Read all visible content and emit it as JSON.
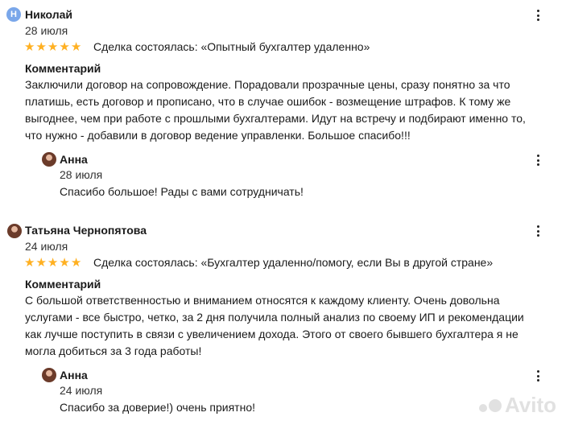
{
  "reviews": [
    {
      "author": "Николай",
      "avatar_letter": "Н",
      "date": "28 июля",
      "rating": 5,
      "deal": "Сделка состоялась: «Опытный бухгалтер удаленно»",
      "comment_title": "Комментарий",
      "comment_lines": [
        "Заключили договор на сопровождение. Порадовали прозрачные цены, сразу понятно за что",
        "платишь, есть договор и прописано, что в случае ошибок - возмещение штрафов. К тому же",
        "выгоднее, чем при работе с прошлыми бухгалтерами. Идут на встречу и подбирают именно то,",
        "что нужно - добавили в договор ведение управленки. Большое спасибо!!!"
      ],
      "reply": {
        "author": "Анна",
        "date": "28 июля",
        "text": "Спасибо большое! Рады с вами сотрудничать!"
      }
    },
    {
      "author": "Татьяна Чернопятова",
      "date": "24 июля",
      "rating": 5,
      "deal": "Сделка состоялась: «Бухгалтер удаленно/помогу, если Вы в другой стране»",
      "comment_title": "Комментарий",
      "comment_lines": [
        "С большой ответственностью и вниманием относятся к каждому клиенту. Очень довольна",
        "услугами - все быстро, четко, за 2 дня получила полный анализ по своему ИП и рекомендации",
        "как лучше поступить в связи с увеличением дохода. Этого от своего бывшего бухгалтера я не",
        "могла добиться за 3 года работы!"
      ],
      "reply": {
        "author": "Анна",
        "date": "24 июля",
        "text": "Спасибо за доверие!) очень приятно!"
      }
    }
  ],
  "watermark": "Avito",
  "colors": {
    "star": "#ffb021",
    "avatar_letter_bg": "#7aa7ea"
  },
  "icons": {
    "menu": "kebab-menu-icon",
    "star": "star-icon"
  }
}
